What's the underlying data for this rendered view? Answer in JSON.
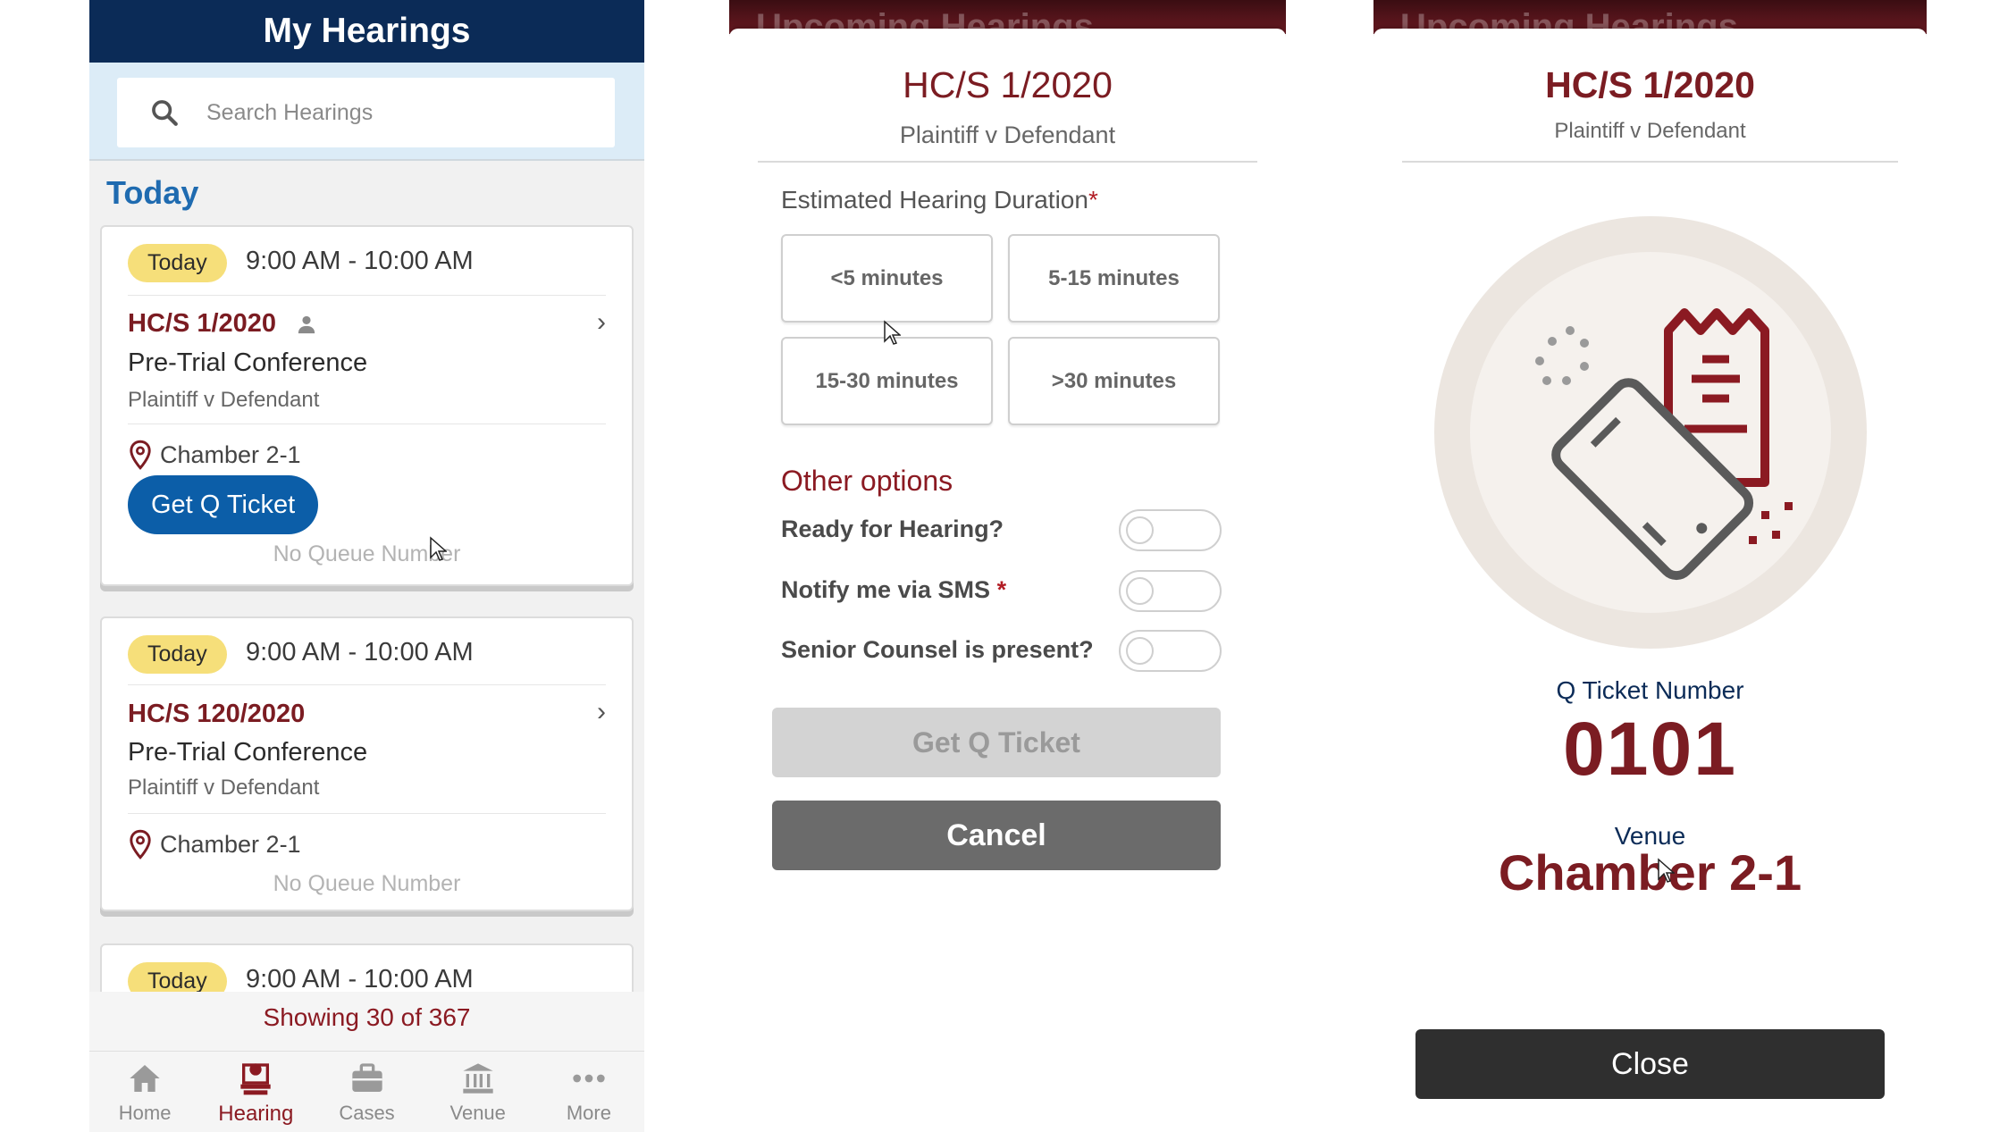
{
  "screen1": {
    "header_title": "My Hearings",
    "search_placeholder": "Search Hearings",
    "section_title": "Today",
    "cards": [
      {
        "badge": "Today",
        "time": "9:00 AM - 10:00 AM",
        "case_no": "HC/S 1/2020",
        "hearing_type": "Pre-Trial Conference",
        "parties": "Plaintiff v Defendant",
        "venue": "Chamber 2-1",
        "button": "Get Q Ticket",
        "queue": "No Queue Number"
      },
      {
        "badge": "Today",
        "time": "9:00 AM - 10:00 AM",
        "case_no": "HC/S 120/2020",
        "hearing_type": "Pre-Trial Conference",
        "parties": "Plaintiff v Defendant",
        "venue": "Chamber 2-1",
        "queue": "No Queue Number"
      },
      {
        "badge": "Today",
        "time": "9:00 AM - 10:00 AM"
      }
    ],
    "showing": "Showing 30 of 367",
    "nav": [
      {
        "label": "Home",
        "icon": "home-icon"
      },
      {
        "label": "Hearing",
        "icon": "hearing-icon",
        "active": true
      },
      {
        "label": "Cases",
        "icon": "briefcase-icon"
      },
      {
        "label": "Venue",
        "icon": "building-icon"
      },
      {
        "label": "More",
        "icon": "more-icon"
      }
    ]
  },
  "screen2": {
    "background_title": "Upcoming Hearings",
    "case_no": "HC/S 1/2020",
    "parties": "Plaintiff v Defendant",
    "duration_label": "Estimated Hearing Duration",
    "duration_required_mark": "*",
    "duration_options": [
      "<5 minutes",
      "5-15 minutes",
      "15-30 minutes",
      ">30 minutes"
    ],
    "other_options_title": "Other options",
    "toggles": [
      {
        "label": "Ready for Hearing?",
        "required": "",
        "on": false
      },
      {
        "label": "Notify me via SMS",
        "required": "*",
        "on": false
      },
      {
        "label": "Senior Counsel is present?",
        "required": "",
        "on": false
      }
    ],
    "get_ticket_button": "Get Q Ticket",
    "cancel_button": "Cancel"
  },
  "screen3": {
    "background_title": "Upcoming Hearings",
    "case_no": "HC/S 1/2020",
    "parties": "Plaintiff v Defendant",
    "ticket_label": "Q Ticket Number",
    "ticket_number": "0101",
    "venue_label": "Venue",
    "venue": "Chamber 2-1",
    "close_button": "Close"
  },
  "colors": {
    "navy": "#0b2b57",
    "maroon": "#7b1c22",
    "blue": "#0c5ea8",
    "badge_yellow": "#f6df7a"
  }
}
